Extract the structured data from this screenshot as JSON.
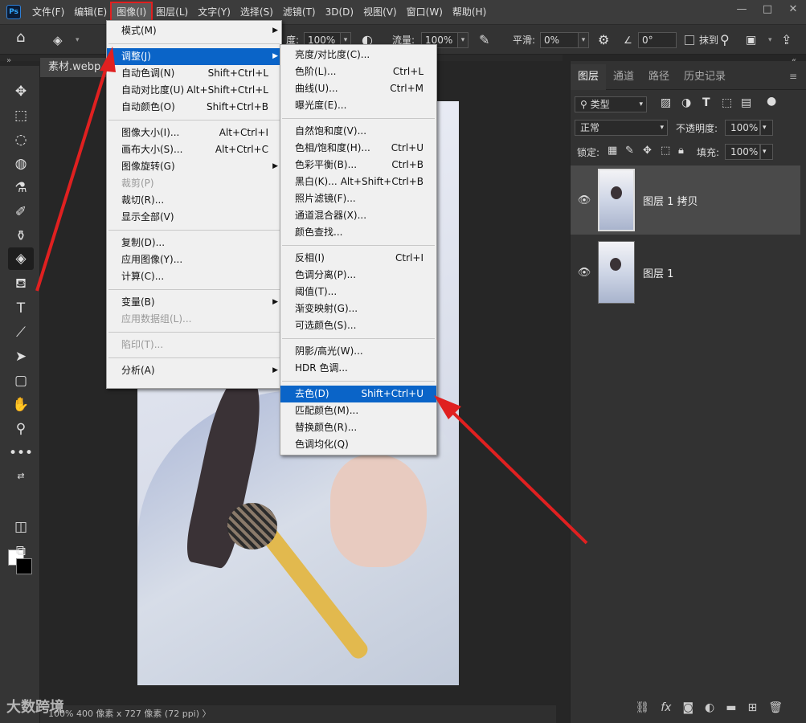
{
  "menubar": {
    "logo": "Ps",
    "items": [
      "文件(F)",
      "编辑(E)",
      "图像(I)",
      "图层(L)",
      "文字(Y)",
      "选择(S)",
      "滤镜(T)",
      "3D(D)",
      "视图(V)",
      "窗口(W)",
      "帮助(H)"
    ],
    "active_index": 2,
    "window_controls": [
      "—",
      "□",
      "✕"
    ]
  },
  "options": {
    "opacity_label": "度:",
    "opacity_value": "100%",
    "flow_label": "流量:",
    "flow_value": "100%",
    "smooth_label": "平滑:",
    "smooth_value": "0%",
    "angle_value": "0°",
    "erase_label": "抹到"
  },
  "document": {
    "tab_title": "素材.webp.jpg",
    "status": "100%    400 像素 x 727 像素 (72 ppi)  〉",
    "watermark": "大数跨境"
  },
  "image_menu": {
    "rows": [
      {
        "label": "模式(M)",
        "shortcut": "",
        "arrow": true,
        "disabled": false,
        "highlight": false
      },
      {
        "label": "调整(J)",
        "shortcut": "",
        "arrow": true,
        "disabled": false,
        "highlight": true
      },
      {
        "label": "自动色调(N)",
        "shortcut": "Shift+Ctrl+L",
        "arrow": false,
        "disabled": false,
        "highlight": false
      },
      {
        "label": "自动对比度(U)",
        "shortcut": "Alt+Shift+Ctrl+L",
        "arrow": false,
        "disabled": false,
        "highlight": false
      },
      {
        "label": "自动颜色(O)",
        "shortcut": "Shift+Ctrl+B",
        "arrow": false,
        "disabled": false,
        "highlight": false
      },
      {
        "label": "图像大小(I)...",
        "shortcut": "Alt+Ctrl+I",
        "arrow": false,
        "disabled": false,
        "highlight": false
      },
      {
        "label": "画布大小(S)...",
        "shortcut": "Alt+Ctrl+C",
        "arrow": false,
        "disabled": false,
        "highlight": false
      },
      {
        "label": "图像旋转(G)",
        "shortcut": "",
        "arrow": true,
        "disabled": false,
        "highlight": false
      },
      {
        "label": "裁剪(P)",
        "shortcut": "",
        "arrow": false,
        "disabled": true,
        "highlight": false
      },
      {
        "label": "裁切(R)...",
        "shortcut": "",
        "arrow": false,
        "disabled": false,
        "highlight": false
      },
      {
        "label": "显示全部(V)",
        "shortcut": "",
        "arrow": false,
        "disabled": false,
        "highlight": false
      },
      {
        "label": "复制(D)...",
        "shortcut": "",
        "arrow": false,
        "disabled": false,
        "highlight": false
      },
      {
        "label": "应用图像(Y)...",
        "shortcut": "",
        "arrow": false,
        "disabled": false,
        "highlight": false
      },
      {
        "label": "计算(C)...",
        "shortcut": "",
        "arrow": false,
        "disabled": false,
        "highlight": false
      },
      {
        "label": "变量(B)",
        "shortcut": "",
        "arrow": true,
        "disabled": false,
        "highlight": false
      },
      {
        "label": "应用数据组(L)...",
        "shortcut": "",
        "arrow": false,
        "disabled": true,
        "highlight": false
      },
      {
        "label": "陷印(T)...",
        "shortcut": "",
        "arrow": false,
        "disabled": true,
        "highlight": false
      },
      {
        "label": "分析(A)",
        "shortcut": "",
        "arrow": true,
        "disabled": false,
        "highlight": false
      }
    ]
  },
  "adjust_menu": {
    "rows": [
      {
        "label": "亮度/对比度(C)...",
        "shortcut": "",
        "highlight": false
      },
      {
        "label": "色阶(L)...",
        "shortcut": "Ctrl+L",
        "highlight": false
      },
      {
        "label": "曲线(U)...",
        "shortcut": "Ctrl+M",
        "highlight": false
      },
      {
        "label": "曝光度(E)...",
        "shortcut": "",
        "highlight": false
      },
      {
        "label": "自然饱和度(V)...",
        "shortcut": "",
        "highlight": false
      },
      {
        "label": "色相/饱和度(H)...",
        "shortcut": "Ctrl+U",
        "highlight": false
      },
      {
        "label": "色彩平衡(B)...",
        "shortcut": "Ctrl+B",
        "highlight": false
      },
      {
        "label": "黑白(K)...",
        "shortcut": "Alt+Shift+Ctrl+B",
        "highlight": false
      },
      {
        "label": "照片滤镜(F)...",
        "shortcut": "",
        "highlight": false
      },
      {
        "label": "通道混合器(X)...",
        "shortcut": "",
        "highlight": false
      },
      {
        "label": "颜色查找...",
        "shortcut": "",
        "highlight": false
      },
      {
        "label": "反相(I)",
        "shortcut": "Ctrl+I",
        "highlight": false
      },
      {
        "label": "色调分离(P)...",
        "shortcut": "",
        "highlight": false
      },
      {
        "label": "阈值(T)...",
        "shortcut": "",
        "highlight": false
      },
      {
        "label": "渐变映射(G)...",
        "shortcut": "",
        "highlight": false
      },
      {
        "label": "可选颜色(S)...",
        "shortcut": "",
        "highlight": false
      },
      {
        "label": "阴影/高光(W)...",
        "shortcut": "",
        "highlight": false
      },
      {
        "label": "HDR 色调...",
        "shortcut": "",
        "highlight": false
      },
      {
        "label": "去色(D)",
        "shortcut": "Shift+Ctrl+U",
        "highlight": true
      },
      {
        "label": "匹配颜色(M)...",
        "shortcut": "",
        "highlight": false
      },
      {
        "label": "替换颜色(R)...",
        "shortcut": "",
        "highlight": false
      },
      {
        "label": "色调均化(Q)",
        "shortcut": "",
        "highlight": false
      }
    ]
  },
  "layers_panel": {
    "tabs": [
      "图层",
      "通道",
      "路径",
      "历史记录"
    ],
    "filter_label": "类型",
    "blend_mode": "正常",
    "opacity_label": "不透明度:",
    "opacity_value": "100%",
    "lock_label": "锁定:",
    "fill_label": "填充:",
    "fill_value": "100%",
    "layers": [
      {
        "name": "图层 1 拷贝",
        "selected": true
      },
      {
        "name": "图层 1",
        "selected": false
      }
    ]
  },
  "colors": {
    "accent": "#0a64c8",
    "arrow": "#e02020"
  }
}
